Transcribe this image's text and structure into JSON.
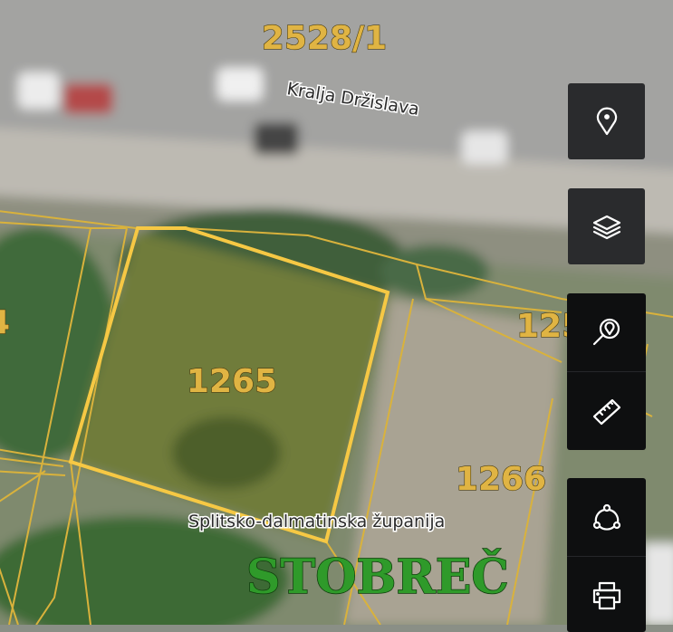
{
  "map": {
    "parcel_labels": [
      "2528/1",
      "1265",
      "1266",
      "125",
      "4"
    ],
    "street_name": "Kralja Držislava",
    "county_name": "Splitsko-dalmatinska županija",
    "place_name": "STOBREČ",
    "colors": {
      "parcel_line": "#d9b23c",
      "selected_parcel": "#f6c844",
      "label": "#e0b443"
    }
  },
  "toolbar": {
    "buttons": [
      {
        "name": "location",
        "icon": "map-pin-icon"
      },
      {
        "name": "layers",
        "icon": "layers-icon"
      },
      {
        "name": "search-location",
        "icon": "search-pin-icon"
      },
      {
        "name": "measure",
        "icon": "ruler-icon"
      },
      {
        "name": "share",
        "icon": "share-nodes-icon"
      },
      {
        "name": "print",
        "icon": "printer-icon"
      }
    ]
  }
}
